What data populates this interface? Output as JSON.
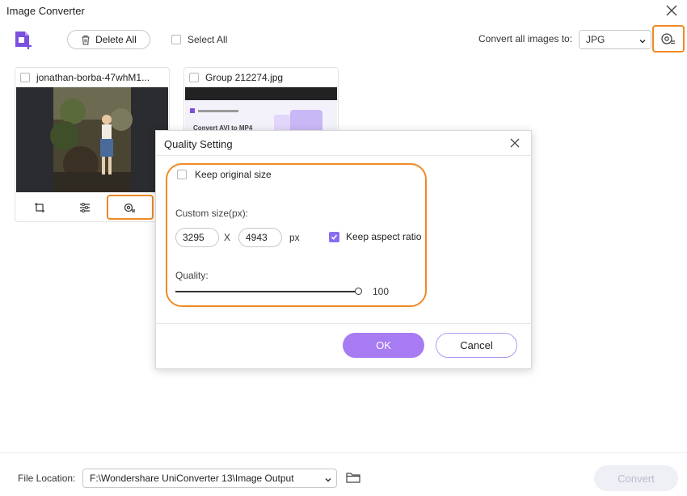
{
  "window": {
    "title": "Image Converter"
  },
  "toolbar": {
    "delete_all": "Delete All",
    "select_all": "Select All",
    "convert_label": "Convert all images to:",
    "format": "JPG"
  },
  "cards": [
    {
      "name": "jonathan-borba-47whM1..."
    },
    {
      "name": "Group 212274.jpg",
      "thumb_heading": "Convert AVI to MP4"
    }
  ],
  "dialog": {
    "title": "Quality Setting",
    "keep_original": "Keep original size",
    "custom_size_label": "Custom size(px):",
    "width": "3295",
    "x_sep": "X",
    "height": "4943",
    "unit": "px",
    "keep_aspect": "Keep aspect ratio",
    "keep_aspect_checked": true,
    "quality_label": "Quality:",
    "quality_value": "100",
    "quality_fraction": 1.0,
    "ok": "OK",
    "cancel": "Cancel"
  },
  "footer": {
    "file_location_label": "File Location:",
    "path": "F:\\Wondershare UniConverter 13\\Image Output",
    "convert": "Convert"
  },
  "colors": {
    "accent": "#a77cf2",
    "highlight": "#f08a24",
    "checkbox_on": "#8a6cf0"
  }
}
